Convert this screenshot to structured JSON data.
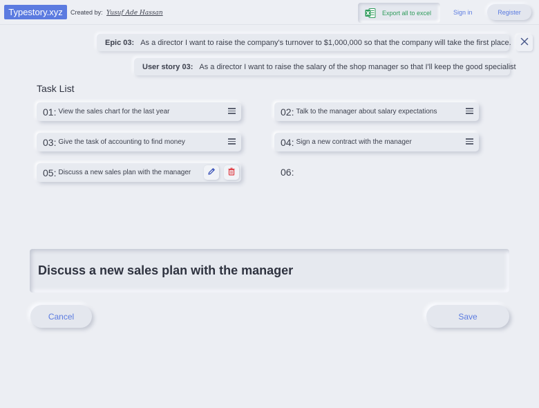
{
  "header": {
    "brand": "Typestory.xyz",
    "created_by_label": "Created by:",
    "author": "Yusuf Ade Hassan",
    "export_label": "Export all to excel",
    "signin_label": "Sign in",
    "register_label": "Register"
  },
  "epic": {
    "label": "Epic 03:",
    "text": "As a director  I want to raise the company's turnover to $1,000,000  so that the company will take the first place."
  },
  "story": {
    "label": "User story 03:",
    "text": "As a director  I want to raise the salary of the shop manager  so that I'll keep the good specialist"
  },
  "task_list": {
    "title": "Task List",
    "tasks": [
      {
        "num": "01:",
        "text": "View the sales chart for the last year"
      },
      {
        "num": "02:",
        "text": "Talk to the manager about salary expectations"
      },
      {
        "num": "03:",
        "text": "Give the task of accounting to find money"
      },
      {
        "num": "04:",
        "text": "Sign a new contract with the manager"
      },
      {
        "num": "05:",
        "text": "Discuss a new sales plan with the manager"
      },
      {
        "num": "06:",
        "text": ""
      }
    ]
  },
  "editor": {
    "value": "Discuss a new sales plan with the manager",
    "cancel_label": "Cancel",
    "save_label": "Save"
  },
  "colors": {
    "accent": "#5b7be0",
    "excel_green": "#2e9b5b",
    "delete_red": "#e0444b",
    "background": "#eceef3"
  },
  "icons": [
    "excel-icon",
    "close-icon",
    "menu-icon",
    "pencil-icon",
    "trash-icon"
  ]
}
